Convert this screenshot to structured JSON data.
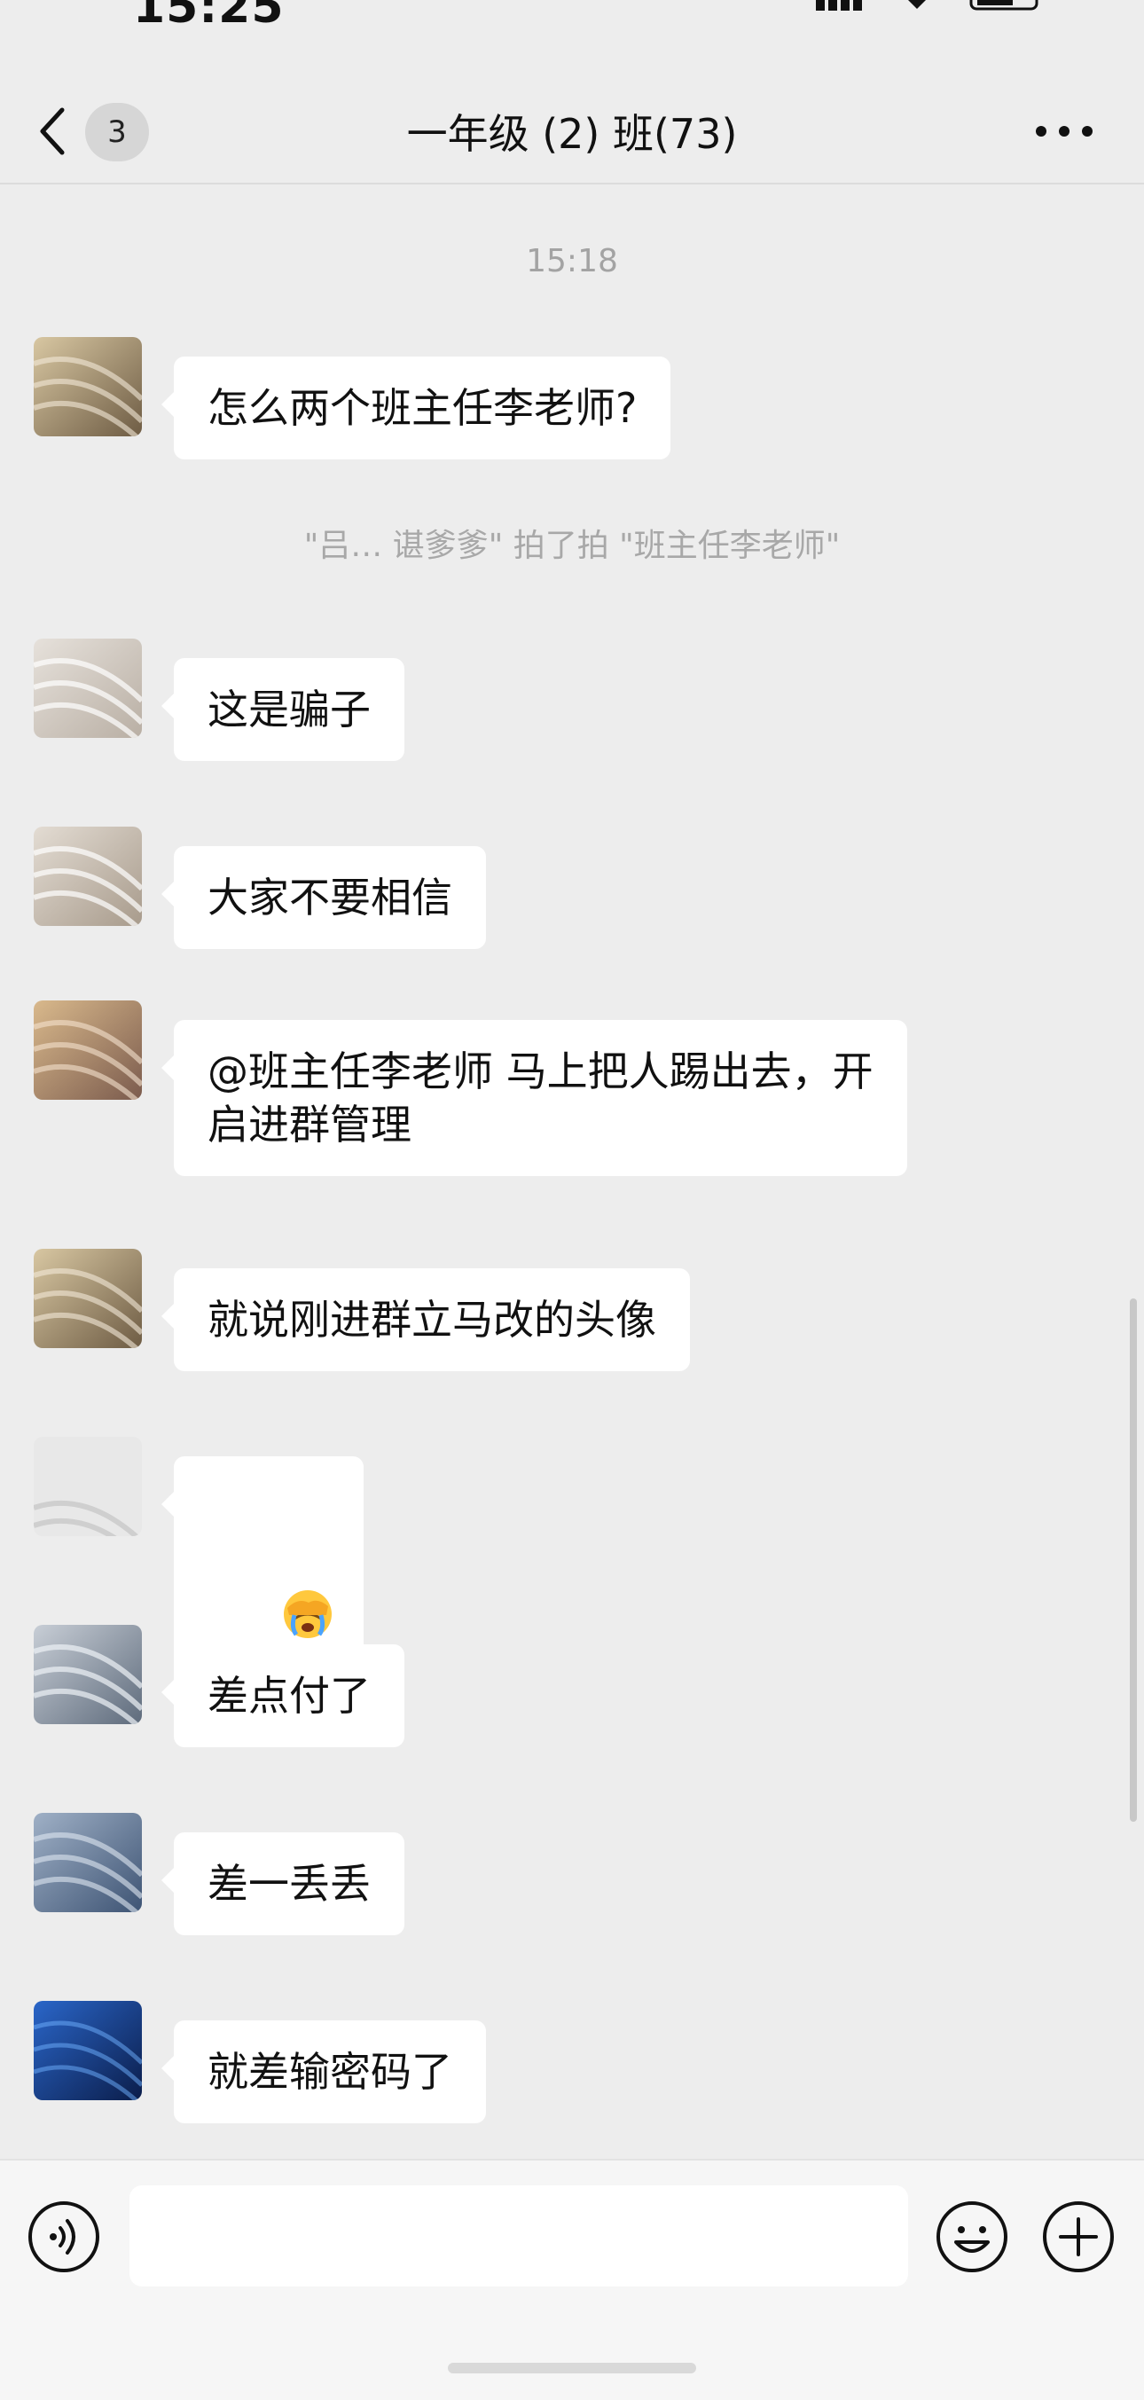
{
  "status_bar": {
    "time": "15:25"
  },
  "header": {
    "unread_count": "3",
    "title": "一年级 (2) 班(73)"
  },
  "chat": {
    "timestamp": "15:18",
    "system_notice": "\"吕… 谌爹爹\" 拍了拍 \"班主任李老师\"",
    "messages": [
      {
        "text": "怎么两个班主任李老师?"
      },
      {
        "text": "这是骗子"
      },
      {
        "text": "大家不要相信"
      },
      {
        "text": "@班主任李老师 马上把人踢出去，开\n启进群管理"
      },
      {
        "text": "就说刚进群立马改的头像"
      },
      {
        "text": "",
        "emoji": "face-with-hand-over-eyes-tears"
      },
      {
        "text": "差点付了"
      },
      {
        "text": "差一丢丢"
      },
      {
        "text": "就差输密码了"
      }
    ]
  },
  "input_bar": {
    "value": "",
    "icons": [
      "voice-icon",
      "emoji-icon",
      "plus-icon"
    ]
  },
  "colors": {
    "background": "#ededed",
    "bubble": "#ffffff",
    "meta_text": "#a3a3a3"
  }
}
